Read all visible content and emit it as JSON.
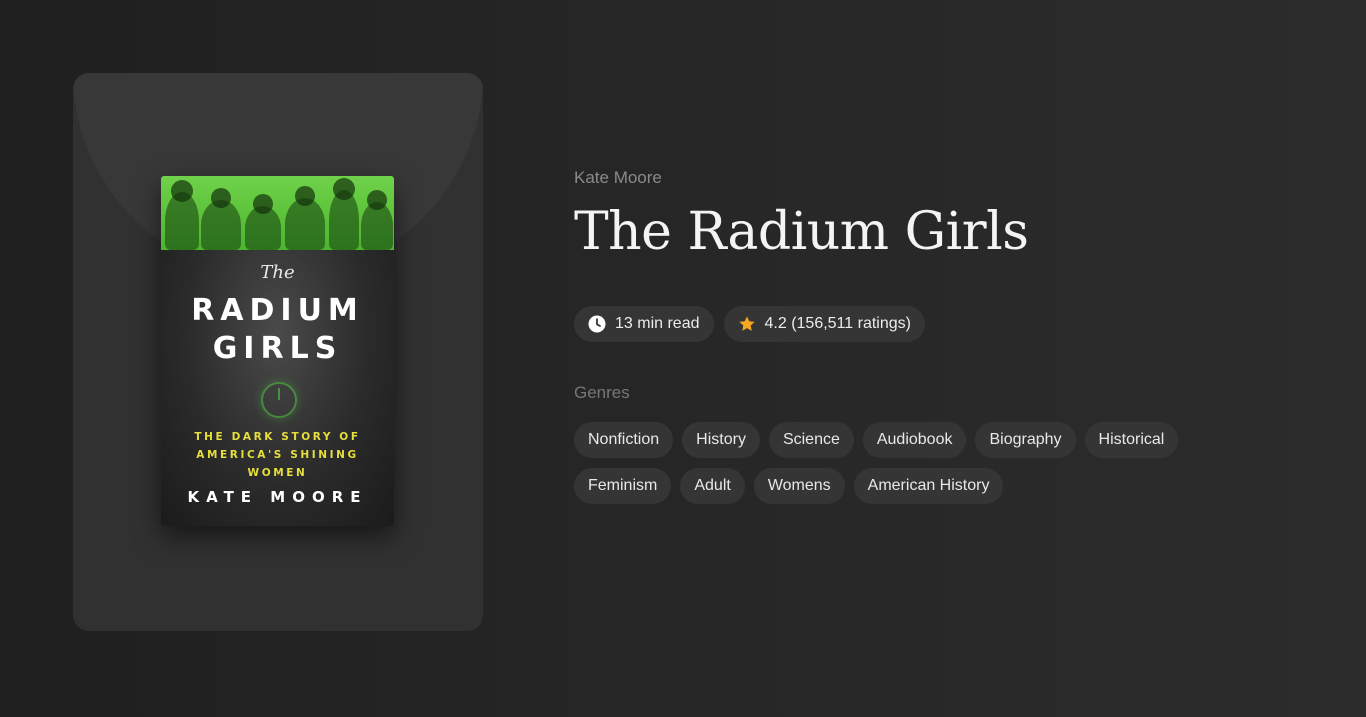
{
  "book": {
    "author": "Kate Moore",
    "title": "The Radium Girls",
    "read_time": "13 min read",
    "rating": "4.2 (156,511 ratings)"
  },
  "cover": {
    "the": "The",
    "title_line1": "RADIUM",
    "title_line2": "GIRLS",
    "subtitle": "THE DARK STORY OF\nAMERICA'S SHINING\nWOMEN",
    "author": "KATE MOORE"
  },
  "genres_label": "Genres",
  "genres": [
    "Nonfiction",
    "History",
    "Science",
    "Audiobook",
    "Biography",
    "Historical",
    "Feminism",
    "Adult",
    "Womens",
    "American History"
  ],
  "icons": {
    "read_time": "clock-icon",
    "rating": "star-icon"
  },
  "colors": {
    "background": "#242424",
    "panel": "#313131",
    "pill": "#353535",
    "star": "#f5a623",
    "cover_green": "#5cc43a",
    "cover_yellow": "#e6df3a"
  }
}
